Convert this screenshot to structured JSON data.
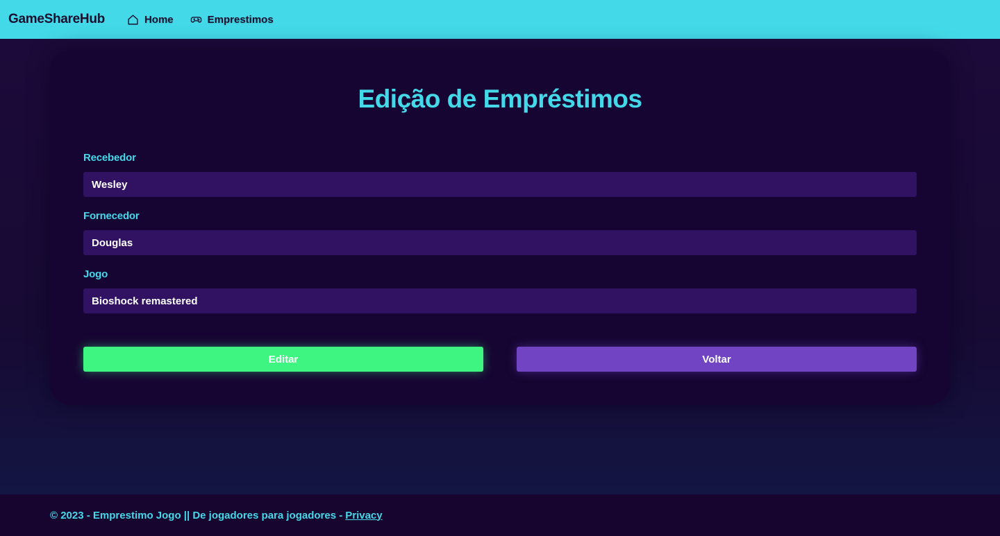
{
  "navbar": {
    "brand": "GameShareHub",
    "links": [
      {
        "label": "Home",
        "icon": "home-icon"
      },
      {
        "label": "Emprestimos",
        "icon": "gamepad-icon"
      }
    ]
  },
  "main": {
    "title": "Edição de Empréstimos",
    "fields": [
      {
        "label": "Recebedor",
        "value": "Wesley"
      },
      {
        "label": "Fornecedor",
        "value": "Douglas"
      },
      {
        "label": "Jogo",
        "value": "Bioshock remastered"
      }
    ],
    "buttons": {
      "edit_label": "Editar",
      "back_label": "Voltar"
    }
  },
  "footer": {
    "text": "© 2023 - Emprestimo Jogo || De jogadores para jogadores -",
    "privacy_label": "Privacy"
  },
  "colors": {
    "navbar_bg": "#44d9e8",
    "accent": "#44d9e8",
    "card_bg": "#160532",
    "input_bg": "#311262",
    "edit_button": "#3ef581",
    "back_button": "#7044c3"
  }
}
